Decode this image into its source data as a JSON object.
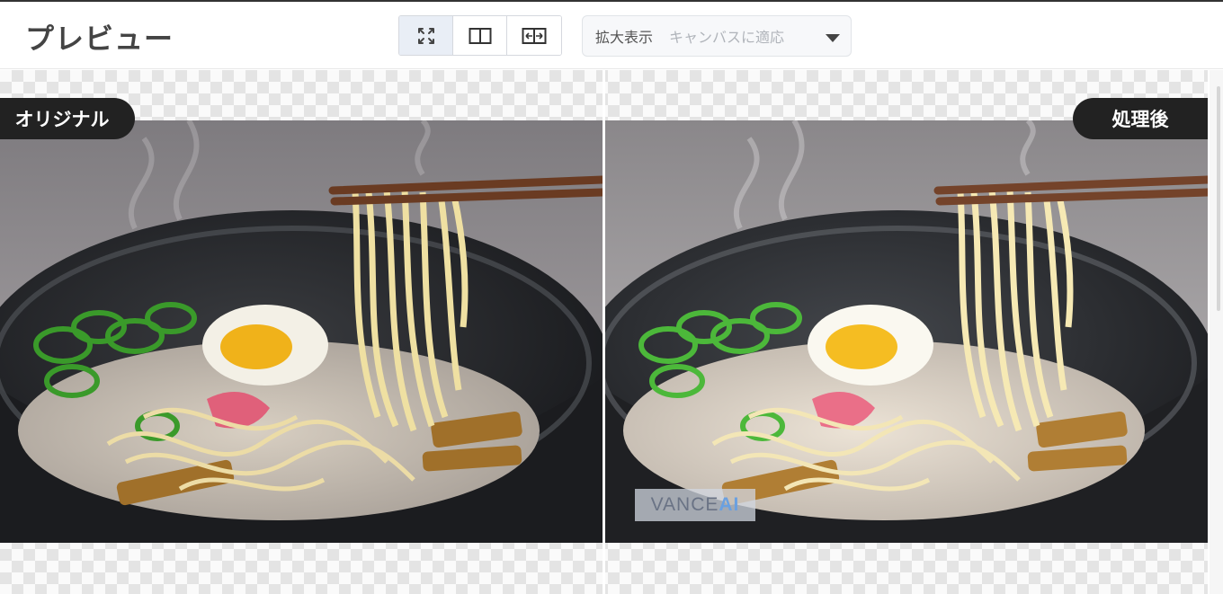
{
  "header": {
    "title": "プレビュー",
    "view_modes": [
      {
        "name": "fit-screen",
        "icon": "fullscreen-icon",
        "active": true
      },
      {
        "name": "split-view",
        "icon": "split-view-icon",
        "active": false
      },
      {
        "name": "compare-slider",
        "icon": "compare-slider-icon",
        "active": false
      }
    ],
    "zoom": {
      "label": "拡大表示",
      "value": "キャンバスに適応"
    }
  },
  "preview": {
    "original_label": "オリジナル",
    "processed_label": "処理後",
    "watermark_main": "VANCE",
    "watermark_ai": "AI"
  },
  "colors": {
    "badge_bg": "#222222",
    "active_view_bg": "#e9eef6",
    "watermark_ai": "#6aa0e0"
  }
}
